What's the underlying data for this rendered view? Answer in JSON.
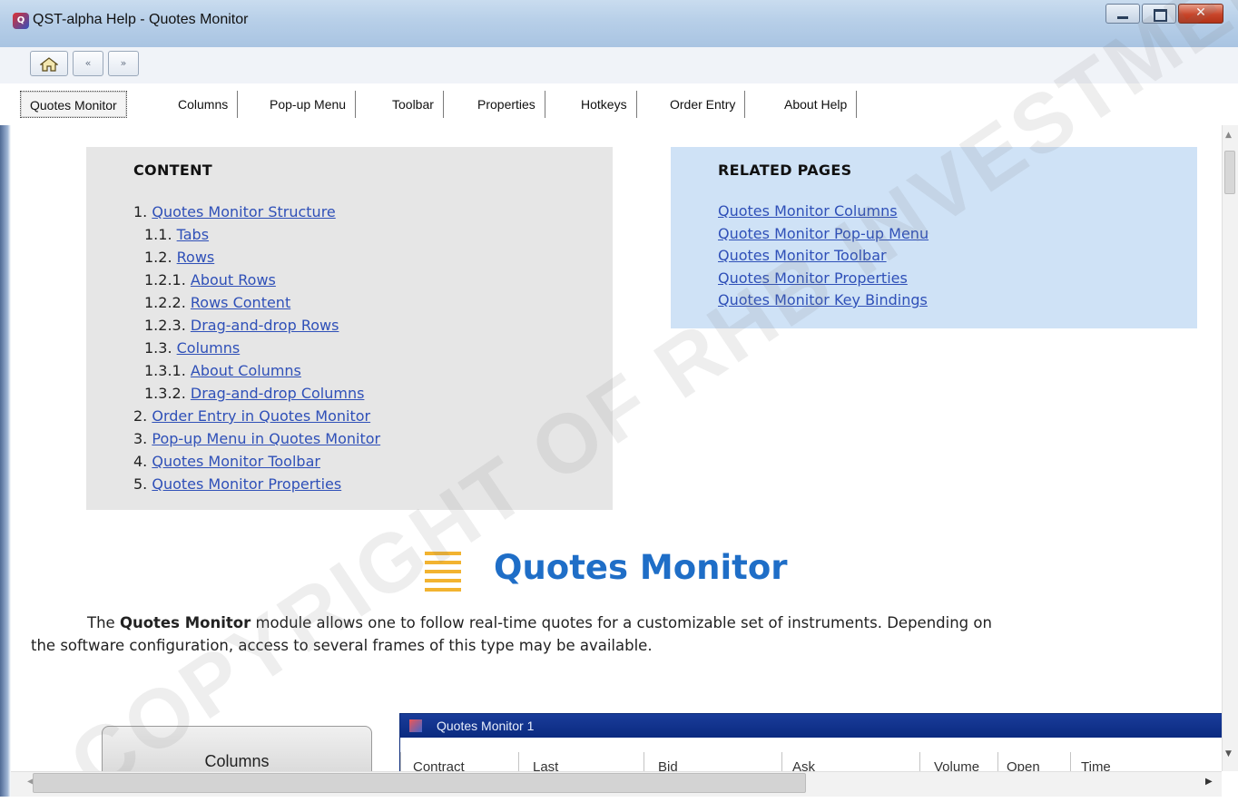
{
  "window": {
    "title": "QST-alpha Help - Quotes Monitor",
    "app_icon": "qst-app-icon"
  },
  "nav": {
    "home_icon": "home-icon",
    "back_label": "«",
    "forward_label": "»"
  },
  "tabs": [
    {
      "label": "Quotes Monitor",
      "active": true
    },
    {
      "label": "Columns"
    },
    {
      "label": "Pop-up Menu"
    },
    {
      "label": "Toolbar"
    },
    {
      "label": "Properties"
    },
    {
      "label": "Hotkeys"
    },
    {
      "label": "Order Entry"
    },
    {
      "label": "About Help"
    }
  ],
  "content": {
    "title": "CONTENT",
    "items": [
      {
        "num": "1.",
        "text": "Quotes Monitor Structure"
      },
      {
        "num": "1.1.",
        "text": "Tabs"
      },
      {
        "num": "1.2.",
        "text": "Rows"
      },
      {
        "num": "1.2.1.",
        "text": "About Rows"
      },
      {
        "num": "1.2.2.",
        "text": "Rows Content"
      },
      {
        "num": "1.2.3.",
        "text": "Drag-and-drop Rows"
      },
      {
        "num": "1.3.",
        "text": "Columns"
      },
      {
        "num": "1.3.1.",
        "text": "About Columns"
      },
      {
        "num": "1.3.2.",
        "text": "Drag-and-drop Columns"
      },
      {
        "num": "2.",
        "text": "Order Entry in Quotes Monitor"
      },
      {
        "num": "3.",
        "text": "Pop-up Menu in Quotes Monitor"
      },
      {
        "num": "4.",
        "text": "Quotes Monitor Toolbar"
      },
      {
        "num": "5.",
        "text": "Quotes Monitor Properties"
      }
    ]
  },
  "related": {
    "title": "RELATED PAGES",
    "links": [
      "Quotes Monitor Columns",
      "Quotes Monitor Pop-up Menu",
      "Quotes Monitor Toolbar",
      "Quotes Monitor Properties",
      "Quotes Monitor Key Bindings"
    ]
  },
  "main": {
    "heading": "Quotes Monitor",
    "desc_pre": "The ",
    "desc_bold": "Quotes Monitor",
    "desc_line1_rest": " module allows one to follow real-time quotes for a customizable set of instruments. Depending on",
    "desc_line2": "the software configuration, access to several frames of this type may be available."
  },
  "preview": {
    "columns_button": "Columns",
    "window_title": "Quotes Monitor 1",
    "columns": [
      "Contract",
      "Last",
      "Bid",
      "Ask",
      "Volume",
      "Open",
      "Time"
    ]
  },
  "watermark": "COPYRIGHT OF RHB INVESTMENT",
  "colors": {
    "link": "#2f50b8",
    "heading": "#1f6ec7",
    "content_bg": "#e6e6e6",
    "related_bg": "#cfe2f6"
  }
}
